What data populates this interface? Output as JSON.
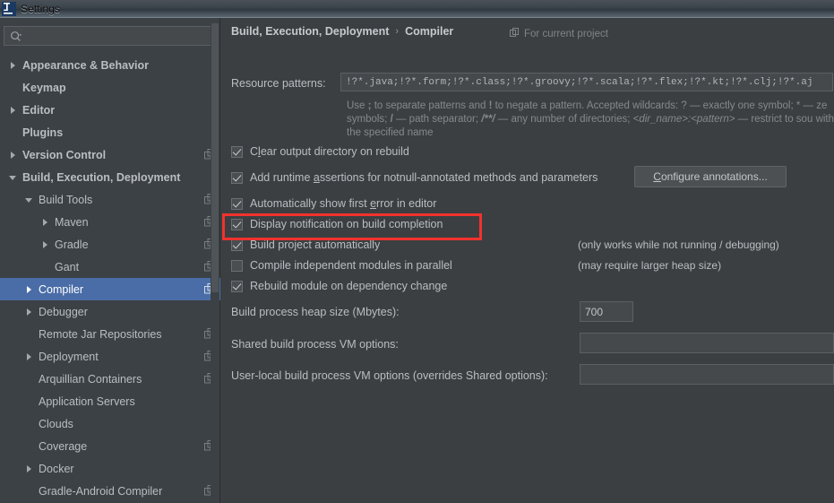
{
  "window": {
    "title": "Settings",
    "app_icon": "intellij-idea-icon"
  },
  "sidebar": {
    "search": {
      "placeholder": "",
      "value": "",
      "icon": "search-icon"
    },
    "items": [
      {
        "label": "Appearance & Behavior",
        "level": 0,
        "arrow": "collapsed",
        "bold": true,
        "scope_icon": false,
        "selected": false
      },
      {
        "label": "Keymap",
        "level": 0,
        "arrow": "none",
        "bold": true,
        "scope_icon": false,
        "selected": false
      },
      {
        "label": "Editor",
        "level": 0,
        "arrow": "collapsed",
        "bold": true,
        "scope_icon": false,
        "selected": false
      },
      {
        "label": "Plugins",
        "level": 0,
        "arrow": "none",
        "bold": true,
        "scope_icon": false,
        "selected": false
      },
      {
        "label": "Version Control",
        "level": 0,
        "arrow": "collapsed",
        "bold": true,
        "scope_icon": true,
        "selected": false
      },
      {
        "label": "Build, Execution, Deployment",
        "level": 0,
        "arrow": "expanded",
        "bold": true,
        "scope_icon": false,
        "selected": false
      },
      {
        "label": "Build Tools",
        "level": 1,
        "arrow": "expanded",
        "bold": false,
        "scope_icon": true,
        "selected": false
      },
      {
        "label": "Maven",
        "level": 2,
        "arrow": "collapsed",
        "bold": false,
        "scope_icon": true,
        "selected": false
      },
      {
        "label": "Gradle",
        "level": 2,
        "arrow": "collapsed",
        "bold": false,
        "scope_icon": true,
        "selected": false
      },
      {
        "label": "Gant",
        "level": 2,
        "arrow": "none",
        "bold": false,
        "scope_icon": true,
        "selected": false
      },
      {
        "label": "Compiler",
        "level": 1,
        "arrow": "collapsed",
        "bold": false,
        "scope_icon": true,
        "selected": true
      },
      {
        "label": "Debugger",
        "level": 1,
        "arrow": "collapsed",
        "bold": false,
        "scope_icon": false,
        "selected": false
      },
      {
        "label": "Remote Jar Repositories",
        "level": 1,
        "arrow": "none",
        "bold": false,
        "scope_icon": true,
        "selected": false
      },
      {
        "label": "Deployment",
        "level": 1,
        "arrow": "collapsed",
        "bold": false,
        "scope_icon": true,
        "selected": false
      },
      {
        "label": "Arquillian Containers",
        "level": 1,
        "arrow": "none",
        "bold": false,
        "scope_icon": true,
        "selected": false
      },
      {
        "label": "Application Servers",
        "level": 1,
        "arrow": "none",
        "bold": false,
        "scope_icon": false,
        "selected": false
      },
      {
        "label": "Clouds",
        "level": 1,
        "arrow": "none",
        "bold": false,
        "scope_icon": false,
        "selected": false
      },
      {
        "label": "Coverage",
        "level": 1,
        "arrow": "none",
        "bold": false,
        "scope_icon": true,
        "selected": false
      },
      {
        "label": "Docker",
        "level": 1,
        "arrow": "collapsed",
        "bold": false,
        "scope_icon": false,
        "selected": false
      },
      {
        "label": "Gradle-Android Compiler",
        "level": 1,
        "arrow": "none",
        "bold": false,
        "scope_icon": true,
        "selected": false
      }
    ]
  },
  "content": {
    "breadcrumb": {
      "root": "Build, Execution, Deployment",
      "separator": "›",
      "leaf": "Compiler"
    },
    "for_current_project": {
      "label": "For current project",
      "icon": "project-scope-icon"
    },
    "resource_patterns": {
      "label": "Resource patterns:",
      "value": "!?*.java;!?*.form;!?*.class;!?*.groovy;!?*.scala;!?*.flex;!?*.kt;!?*.clj;!?*.aj"
    },
    "hint_line1_a": "Use ",
    "hint_semicolon": ";",
    "hint_line1_b": " to separate patterns and ",
    "hint_bang": "!",
    "hint_line1_c": " to negate a pattern. Accepted wildcards: ? — exactly one symbol; * — ze",
    "hint_line2_a": "symbols; ",
    "hint_slash": "/",
    "hint_line2_b": " — path separator; ",
    "hint_globstar": "/**/",
    "hint_line2_c": " — any number of directories;  ",
    "hint_dirname": "<dir_name>:<pattern>",
    "hint_line2_d": " — restrict to sou",
    "hint_line3": "with the specified name",
    "checkboxes": [
      {
        "label": "Clear output directory on rebuild",
        "checked": true,
        "mnemonic_index": 1
      },
      {
        "label": "Add runtime assertions for notnull-annotated methods and parameters",
        "checked": true,
        "mnemonic_index": 12
      },
      {
        "label": "Automatically show first error in editor",
        "checked": true,
        "mnemonic_index": 29
      },
      {
        "label": "Display notification on build completion",
        "checked": true,
        "mnemonic_index": -1
      },
      {
        "label": "Build project automatically",
        "checked": true,
        "mnemonic_index": -1
      },
      {
        "label": "Compile independent modules in parallel",
        "checked": false,
        "mnemonic_index": -1
      },
      {
        "label": "Rebuild module on dependency change",
        "checked": true,
        "mnemonic_index": -1
      }
    ],
    "notes": [
      "(only works while not running / debugging)",
      "(may require larger heap size)"
    ],
    "configure_annotations_button": "Configure annotations...",
    "heap_size": {
      "label": "Build process heap size (Mbytes):",
      "value": "700"
    },
    "shared_vm": {
      "label": "Shared build process VM options:",
      "value": ""
    },
    "user_vm": {
      "label": "User-local build process VM options (overrides Shared options):",
      "value": ""
    }
  },
  "annotation": {
    "highlight_color": "#f2322d",
    "target": "Build project automatically"
  },
  "colors": {
    "selection_blue": "#4a6da7",
    "panel_bg": "#3c3f41",
    "sidebar_bg": "#3c4146",
    "field_bg": "#45494c",
    "text": "#b9bec2",
    "muted_text": "#85898c"
  }
}
